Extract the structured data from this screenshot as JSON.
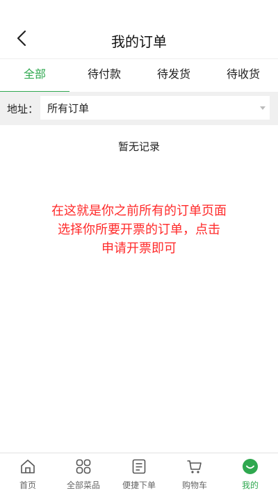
{
  "header": {
    "title": "我的订单",
    "back_icon": "chevron-left-icon"
  },
  "tabs": [
    {
      "label": "全部",
      "active": true
    },
    {
      "label": "待付款",
      "active": false
    },
    {
      "label": "待发货",
      "active": false
    },
    {
      "label": "待收货",
      "active": false
    }
  ],
  "filter": {
    "label": "地址：",
    "selected": "所有订单"
  },
  "empty_text": "暂无记录",
  "note": {
    "line1": "在这就是你之前所有的订单页面",
    "line2": "选择你所要开票的订单，点击",
    "line3": "申请开票即可"
  },
  "colors": {
    "accent": "#2fa84f",
    "note": "#ff2a2a"
  },
  "tabbar": [
    {
      "label": "首页",
      "icon": "home-icon",
      "active": false
    },
    {
      "label": "全部菜品",
      "icon": "grid-icon",
      "active": false
    },
    {
      "label": "便捷下单",
      "icon": "order-icon",
      "active": false
    },
    {
      "label": "购物车",
      "icon": "cart-icon",
      "active": false
    },
    {
      "label": "我的",
      "icon": "smile-icon",
      "active": true
    }
  ]
}
